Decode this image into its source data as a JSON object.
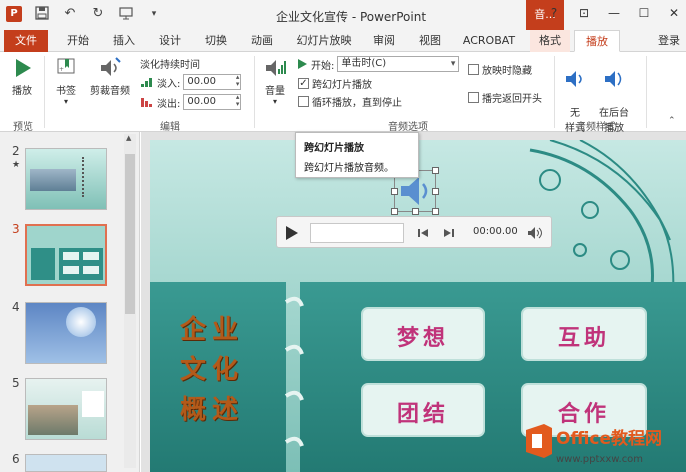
{
  "titlebar": {
    "title": "企业文化宣传 - PowerPoint",
    "context_tab": "音...",
    "help": "?",
    "ribbon_display": "⊡",
    "minimize": "—",
    "maximize": "☐",
    "close": "✕",
    "login": "登录"
  },
  "tabs": [
    "文件",
    "开始",
    "插入",
    "设计",
    "切换",
    "动画",
    "幻灯片放映",
    "审阅",
    "视图",
    "ACROBAT",
    "格式",
    "播放"
  ],
  "ribbon": {
    "preview": {
      "play_label": "播放",
      "group": "预览"
    },
    "edit": {
      "bookmark_label": "书签",
      "trim_label": "剪裁音频",
      "fade_title": "淡化持续时间",
      "fade_in_label": "淡入:",
      "fade_in_value": "00.00",
      "fade_out_label": "淡出:",
      "fade_out_value": "00.00",
      "group": "编辑"
    },
    "audio_options": {
      "volume_label": "音量",
      "start_label": "开始:",
      "start_value": "单击时(C)",
      "cross_slides_label": "跨幻灯片播放",
      "loop_label": "循环播放，直到停止",
      "hide_label": "放映时隐藏",
      "rewind_label": "播完返回开头",
      "group": "音频选项"
    },
    "audio_styles": {
      "no_style_label": "无\n样式",
      "background_label": "在后台\n播放",
      "group": "音频样式"
    }
  },
  "tooltip": {
    "title": "跨幻灯片播放",
    "desc": "跨幻灯片播放音频。"
  },
  "thumbnails": [
    {
      "num": "2",
      "star": "★"
    },
    {
      "num": "3",
      "star": ""
    },
    {
      "num": "4",
      "star": ""
    },
    {
      "num": "5",
      "star": ""
    },
    {
      "num": "6",
      "star": ""
    }
  ],
  "slide": {
    "left_title": [
      "企业",
      "文化",
      "概述"
    ],
    "cards": [
      "梦想",
      "互助",
      "团结",
      "合作"
    ]
  },
  "player": {
    "time": "00:00.00"
  },
  "watermark": {
    "brand": "Office教程网",
    "url": "www.pptxxw.com"
  },
  "colors": {
    "accent": "#c43e1c",
    "slide_teal": "#2f8f87",
    "card_text": "#c0337a",
    "title_brown": "#b35a1a"
  }
}
